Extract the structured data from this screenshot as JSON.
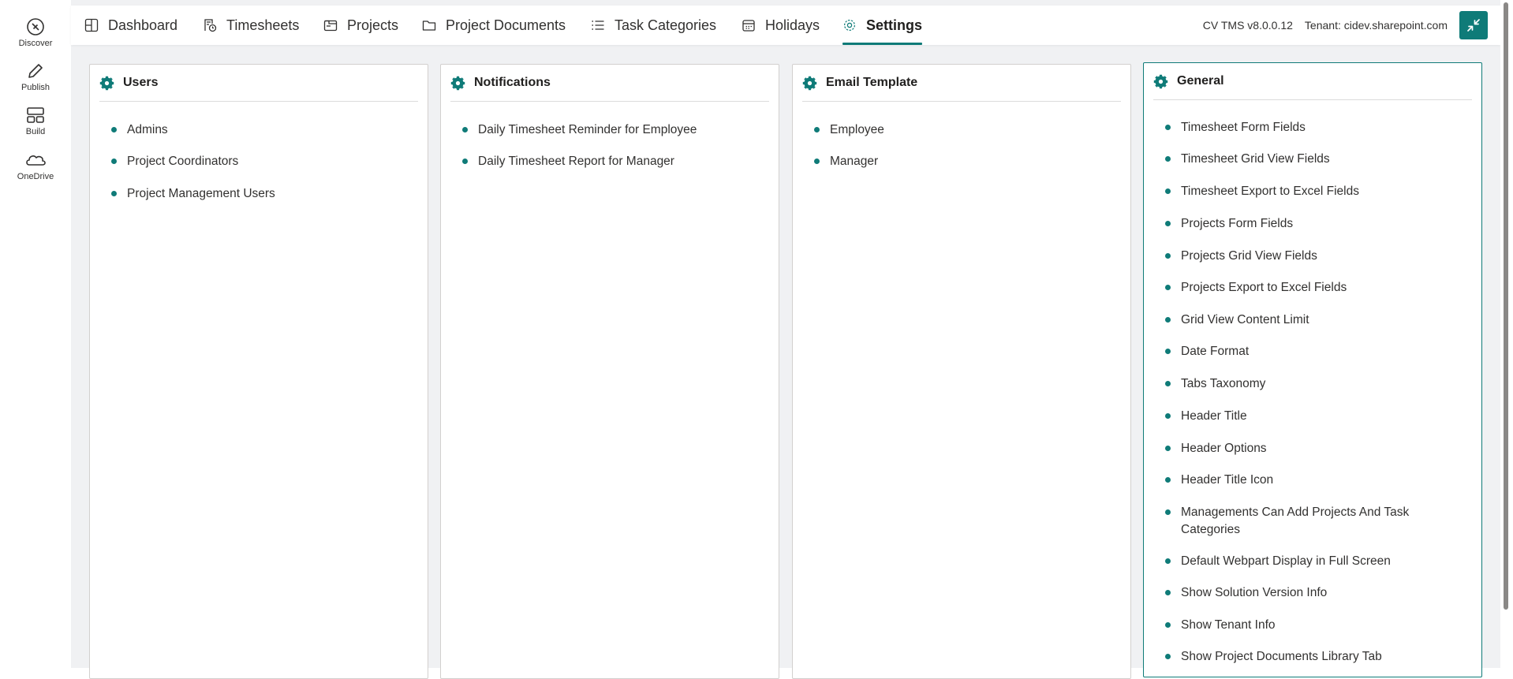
{
  "app_bar": [
    {
      "label": "Discover",
      "icon": "compass-icon"
    },
    {
      "label": "Publish",
      "icon": "pencil-icon"
    },
    {
      "label": "Build",
      "icon": "layout-icon"
    },
    {
      "label": "OneDrive",
      "icon": "cloud-icon"
    }
  ],
  "nav": {
    "tabs": [
      {
        "label": "Dashboard",
        "icon": "dashboard-icon"
      },
      {
        "label": "Timesheets",
        "icon": "timesheet-icon"
      },
      {
        "label": "Projects",
        "icon": "projects-icon"
      },
      {
        "label": "Project Documents",
        "icon": "folder-icon"
      },
      {
        "label": "Task Categories",
        "icon": "list-icon"
      },
      {
        "label": "Holidays",
        "icon": "calendar-icon"
      },
      {
        "label": "Settings",
        "icon": "gear-icon"
      }
    ],
    "active": "Settings"
  },
  "topbar": {
    "version": "CV TMS v8.0.0.12",
    "tenant": "Tenant: cidev.sharepoint.com",
    "collapse_icon": "collapse-arrows-icon"
  },
  "colors": {
    "accent": "#0f7b78",
    "background": "#f0f1f3"
  },
  "cards": [
    {
      "title": "Users",
      "items": [
        "Admins",
        "Project Coordinators",
        "Project Management Users"
      ]
    },
    {
      "title": "Notifications",
      "items": [
        "Daily Timesheet Reminder for Employee",
        "Daily Timesheet Report for Manager"
      ]
    },
    {
      "title": "Email Template",
      "items": [
        "Employee",
        "Manager"
      ]
    },
    {
      "title": "General",
      "items": [
        "Timesheet Form Fields",
        "Timesheet Grid View Fields",
        "Timesheet Export to Excel Fields",
        "Projects Form Fields",
        "Projects Grid View Fields",
        "Projects Export to Excel Fields",
        "Grid View Content Limit",
        "Date Format",
        "Tabs Taxonomy",
        "Header Title",
        "Header Options",
        "Header Title Icon",
        "Managements Can Add Projects And Task Categories",
        "Default Webpart Display in Full Screen",
        "Show Solution Version Info",
        "Show Tenant Info",
        "Show Project Documents Library Tab"
      ]
    }
  ]
}
